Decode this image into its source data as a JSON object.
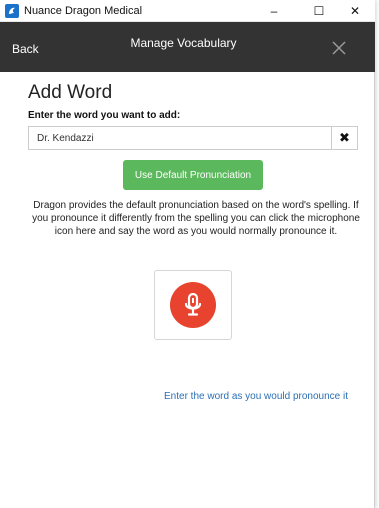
{
  "window": {
    "title": "Nuance Dragon Medical",
    "minimize_symbol": "–",
    "maximize_symbol": "☐",
    "close_symbol": "✕"
  },
  "header": {
    "back_label": "Back",
    "title": "Manage Vocabulary"
  },
  "main": {
    "page_title": "Add Word",
    "field_label": "Enter the word you want to add:",
    "word_value": "Dr. Kendazzi",
    "clear_symbol": "✖",
    "default_button_label": "Use Default Pronunciation",
    "description": "Dragon provides the default pronunciation based on the word's spelling. If you pronounce it differently from the spelling you can click the microphone icon here and say the word as you would normally pronounce it.",
    "pronounce_link": "Enter the word as you would pronounce it"
  },
  "colors": {
    "header_bg": "#333333",
    "accent_green": "#5cb85c",
    "mic_red": "#e8432e",
    "link_blue": "#2a6fb5",
    "app_icon_blue": "#1a73c9"
  },
  "icons": {
    "app": "dragon-app-icon",
    "close": "close-icon",
    "clear": "clear-x-icon",
    "microphone": "microphone-icon"
  }
}
